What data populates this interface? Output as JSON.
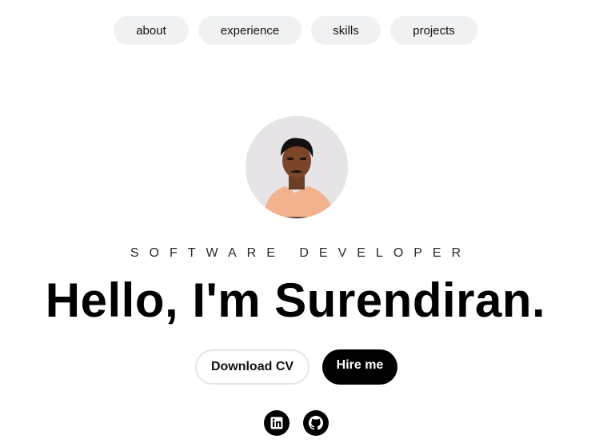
{
  "nav": {
    "items": [
      {
        "label": "about"
      },
      {
        "label": "experience"
      },
      {
        "label": "skills"
      },
      {
        "label": "projects"
      }
    ]
  },
  "hero": {
    "role": "SOFTWARE DEVELOPER",
    "headline": "Hello, I'm Surendiran.",
    "download_label": "Download CV",
    "hire_label": "Hire me"
  },
  "social": {
    "items": [
      {
        "icon": "linkedin-icon"
      },
      {
        "icon": "github-icon"
      }
    ]
  },
  "colors": {
    "background": "#ffffff",
    "pill": "#f0f1f3",
    "primary": "#000000",
    "avatar_bg": "#e6e4e6"
  }
}
